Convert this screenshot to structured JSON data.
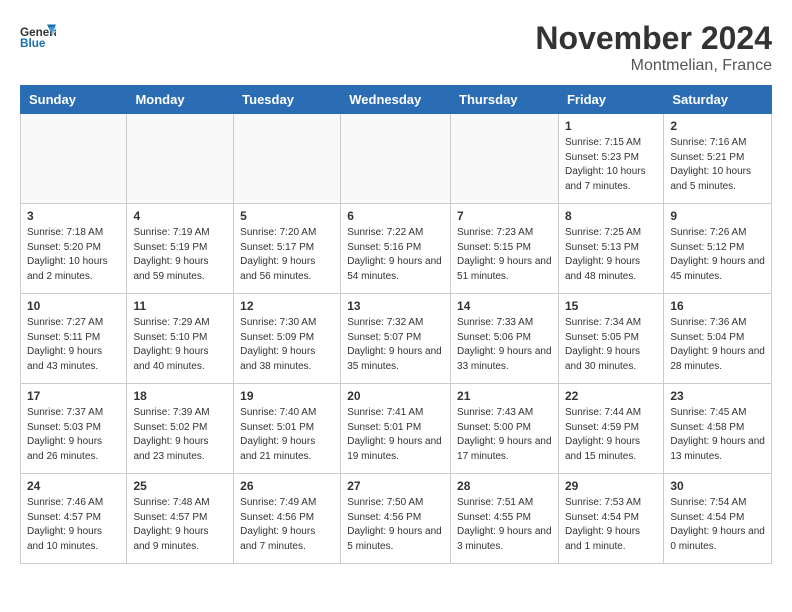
{
  "header": {
    "logo_general": "General",
    "logo_blue": "Blue",
    "month_title": "November 2024",
    "location": "Montmelian, France"
  },
  "days_of_week": [
    "Sunday",
    "Monday",
    "Tuesday",
    "Wednesday",
    "Thursday",
    "Friday",
    "Saturday"
  ],
  "weeks": [
    [
      {
        "day": "",
        "info": ""
      },
      {
        "day": "",
        "info": ""
      },
      {
        "day": "",
        "info": ""
      },
      {
        "day": "",
        "info": ""
      },
      {
        "day": "",
        "info": ""
      },
      {
        "day": "1",
        "info": "Sunrise: 7:15 AM\nSunset: 5:23 PM\nDaylight: 10 hours and 7 minutes."
      },
      {
        "day": "2",
        "info": "Sunrise: 7:16 AM\nSunset: 5:21 PM\nDaylight: 10 hours and 5 minutes."
      }
    ],
    [
      {
        "day": "3",
        "info": "Sunrise: 7:18 AM\nSunset: 5:20 PM\nDaylight: 10 hours and 2 minutes."
      },
      {
        "day": "4",
        "info": "Sunrise: 7:19 AM\nSunset: 5:19 PM\nDaylight: 9 hours and 59 minutes."
      },
      {
        "day": "5",
        "info": "Sunrise: 7:20 AM\nSunset: 5:17 PM\nDaylight: 9 hours and 56 minutes."
      },
      {
        "day": "6",
        "info": "Sunrise: 7:22 AM\nSunset: 5:16 PM\nDaylight: 9 hours and 54 minutes."
      },
      {
        "day": "7",
        "info": "Sunrise: 7:23 AM\nSunset: 5:15 PM\nDaylight: 9 hours and 51 minutes."
      },
      {
        "day": "8",
        "info": "Sunrise: 7:25 AM\nSunset: 5:13 PM\nDaylight: 9 hours and 48 minutes."
      },
      {
        "day": "9",
        "info": "Sunrise: 7:26 AM\nSunset: 5:12 PM\nDaylight: 9 hours and 45 minutes."
      }
    ],
    [
      {
        "day": "10",
        "info": "Sunrise: 7:27 AM\nSunset: 5:11 PM\nDaylight: 9 hours and 43 minutes."
      },
      {
        "day": "11",
        "info": "Sunrise: 7:29 AM\nSunset: 5:10 PM\nDaylight: 9 hours and 40 minutes."
      },
      {
        "day": "12",
        "info": "Sunrise: 7:30 AM\nSunset: 5:09 PM\nDaylight: 9 hours and 38 minutes."
      },
      {
        "day": "13",
        "info": "Sunrise: 7:32 AM\nSunset: 5:07 PM\nDaylight: 9 hours and 35 minutes."
      },
      {
        "day": "14",
        "info": "Sunrise: 7:33 AM\nSunset: 5:06 PM\nDaylight: 9 hours and 33 minutes."
      },
      {
        "day": "15",
        "info": "Sunrise: 7:34 AM\nSunset: 5:05 PM\nDaylight: 9 hours and 30 minutes."
      },
      {
        "day": "16",
        "info": "Sunrise: 7:36 AM\nSunset: 5:04 PM\nDaylight: 9 hours and 28 minutes."
      }
    ],
    [
      {
        "day": "17",
        "info": "Sunrise: 7:37 AM\nSunset: 5:03 PM\nDaylight: 9 hours and 26 minutes."
      },
      {
        "day": "18",
        "info": "Sunrise: 7:39 AM\nSunset: 5:02 PM\nDaylight: 9 hours and 23 minutes."
      },
      {
        "day": "19",
        "info": "Sunrise: 7:40 AM\nSunset: 5:01 PM\nDaylight: 9 hours and 21 minutes."
      },
      {
        "day": "20",
        "info": "Sunrise: 7:41 AM\nSunset: 5:01 PM\nDaylight: 9 hours and 19 minutes."
      },
      {
        "day": "21",
        "info": "Sunrise: 7:43 AM\nSunset: 5:00 PM\nDaylight: 9 hours and 17 minutes."
      },
      {
        "day": "22",
        "info": "Sunrise: 7:44 AM\nSunset: 4:59 PM\nDaylight: 9 hours and 15 minutes."
      },
      {
        "day": "23",
        "info": "Sunrise: 7:45 AM\nSunset: 4:58 PM\nDaylight: 9 hours and 13 minutes."
      }
    ],
    [
      {
        "day": "24",
        "info": "Sunrise: 7:46 AM\nSunset: 4:57 PM\nDaylight: 9 hours and 10 minutes."
      },
      {
        "day": "25",
        "info": "Sunrise: 7:48 AM\nSunset: 4:57 PM\nDaylight: 9 hours and 9 minutes."
      },
      {
        "day": "26",
        "info": "Sunrise: 7:49 AM\nSunset: 4:56 PM\nDaylight: 9 hours and 7 minutes."
      },
      {
        "day": "27",
        "info": "Sunrise: 7:50 AM\nSunset: 4:56 PM\nDaylight: 9 hours and 5 minutes."
      },
      {
        "day": "28",
        "info": "Sunrise: 7:51 AM\nSunset: 4:55 PM\nDaylight: 9 hours and 3 minutes."
      },
      {
        "day": "29",
        "info": "Sunrise: 7:53 AM\nSunset: 4:54 PM\nDaylight: 9 hours and 1 minute."
      },
      {
        "day": "30",
        "info": "Sunrise: 7:54 AM\nSunset: 4:54 PM\nDaylight: 9 hours and 0 minutes."
      }
    ]
  ]
}
